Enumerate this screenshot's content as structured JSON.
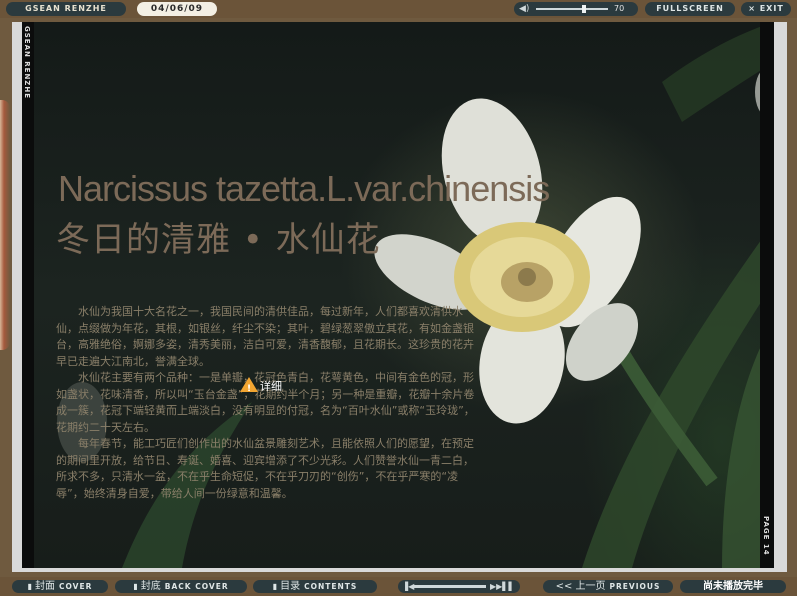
{
  "topbar": {
    "brand": "GSEAN RENZHE",
    "date": "04/06/09",
    "volume": 70,
    "fullscreen": "FULLSCREEN",
    "exit": "× EXIT"
  },
  "page": {
    "spine_left": "GSEAN RENZHE",
    "spine_right": "PAGE 14",
    "title_en": "Narcissus tazetta.L.var.chinensis",
    "title_cn": "冬日的清雅 • 水仙花",
    "paragraphs": [
      "水仙为我国十大名花之一，我国民间的清供佳品，每过新年，人们都喜欢清供水仙，点缀做为年花，其根，如银丝，纤尘不染；其叶，碧绿葱翠傲立其花，有如金盏银台，高雅绝俗，婀娜多姿，清秀美丽，洁白可爱，清香馥郁，且花期长。这珍贵的花卉早已走遍大江南北，誉满全球。",
      "水仙花主要有两个品种：一是单瓣，花冠色青白，花萼黄色，中间有金色的冠，形如盏状，花味清香，所以叫“玉台金盏”，花期约半个月；另一种是重瓣，花瓣十余片卷成一簇，花冠下端轻黄而上端淡白，没有明显的付冠，名为“百叶水仙”或称“玉玲珑”，花期约二十天左右。",
      "每年春节，能工巧匠们创作出的水仙盆景雕刻艺术，且能依照人们的愿望，在预定的期间里开放，给节日、寿诞、婚喜、迎宾增添了不少光彩。人们赞誉水仙一青二白，所求不多，只清水一盆，不在乎生命短促，不在乎刀刃的“创伤”，不在乎严寒的“凌辱”，始终清身自爱，带给人间一份绿意和温馨。"
    ],
    "warning_label": "详细"
  },
  "bottombar": {
    "cover_cn": "封面",
    "cover_en": "COVER",
    "back_cn": "封底",
    "back_en": "BACK COVER",
    "contents_cn": "目录",
    "contents_en": "CONTENTS",
    "prev_cn": "<< 上一页",
    "prev_en": "PREVIOUS",
    "status": "尚未播放完毕"
  },
  "icons": {
    "speaker": "speaker-icon",
    "player_prev": "skip-back-icon",
    "player_next": "skip-forward-icon",
    "warning": "warning-icon"
  },
  "colors": {
    "bar_bg": "#6b5439",
    "pill_bg": "#2b3a3e",
    "title_color": "#7c6a58",
    "warning": "#f2a531"
  }
}
